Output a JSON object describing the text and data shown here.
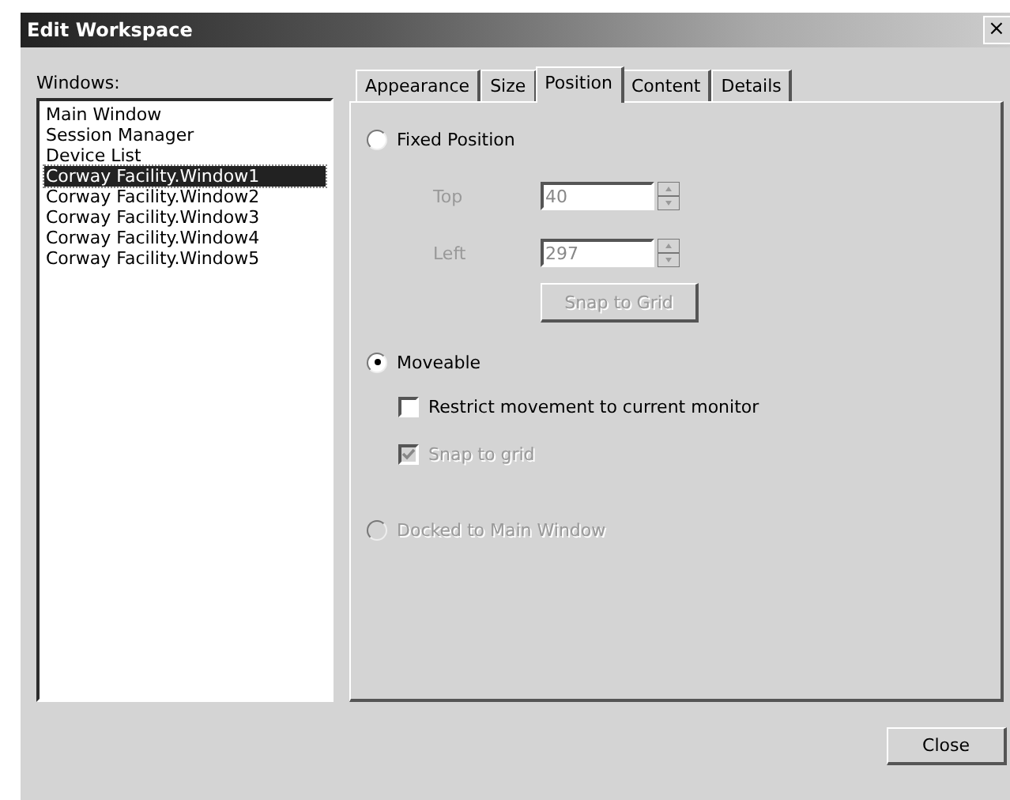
{
  "window": {
    "title": "Edit Workspace",
    "close_glyph": "×"
  },
  "windows_label": "Windows:",
  "windows": [
    {
      "label": "Main Window",
      "selected": false
    },
    {
      "label": "Session Manager",
      "selected": false
    },
    {
      "label": "Device List",
      "selected": false
    },
    {
      "label": "Corway Facility.Window1",
      "selected": true
    },
    {
      "label": "Corway Facility.Window2",
      "selected": false
    },
    {
      "label": "Corway Facility.Window3",
      "selected": false
    },
    {
      "label": "Corway Facility.Window4",
      "selected": false
    },
    {
      "label": "Corway Facility.Window5",
      "selected": false
    }
  ],
  "tabs": [
    {
      "label": "Appearance",
      "selected": false
    },
    {
      "label": "Size",
      "selected": false
    },
    {
      "label": "Position",
      "selected": true
    },
    {
      "label": "Content",
      "selected": false
    },
    {
      "label": "Details",
      "selected": false
    }
  ],
  "fixed_position": {
    "label": "Fixed Position",
    "selected": false,
    "disabled": false
  },
  "top": {
    "label": "Top",
    "value": "40",
    "disabled": true
  },
  "left": {
    "label": "Left",
    "value": "297",
    "disabled": true
  },
  "snap_button": {
    "label": "Snap to Grid",
    "disabled": true
  },
  "moveable": {
    "label": "Moveable",
    "selected": true,
    "disabled": false
  },
  "restrict": {
    "label": "Restrict movement to current monitor",
    "checked": false,
    "disabled": false
  },
  "snap_grid": {
    "label": "Snap to grid",
    "checked": true,
    "disabled": true
  },
  "docked": {
    "label": "Docked to Main Window",
    "selected": false,
    "disabled": true
  },
  "close_button": "Close"
}
